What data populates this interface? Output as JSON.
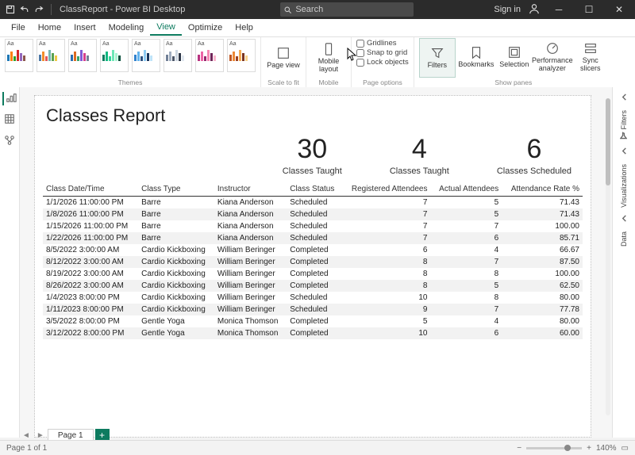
{
  "titlebar": {
    "app_title": "ClassReport - Power BI Desktop",
    "search_placeholder": "Search",
    "signin": "Sign in"
  },
  "menu": {
    "file": "File",
    "home": "Home",
    "insert": "Insert",
    "modeling": "Modeling",
    "view": "View",
    "optimize": "Optimize",
    "help": "Help"
  },
  "ribbon": {
    "group_themes": "Themes",
    "group_scale": "Scale to fit",
    "group_mobile": "Mobile",
    "group_pageopts": "Page options",
    "group_showpanes": "Show panes",
    "page_view": "Page view",
    "mobile_layout": "Mobile layout",
    "gridlines": "Gridlines",
    "snap": "Snap to grid",
    "lock": "Lock objects",
    "filters": "Filters",
    "bookmarks": "Bookmarks",
    "selection": "Selection",
    "perf": "Performance analyzer",
    "sync": "Sync slicers"
  },
  "right_panels": {
    "filters": "Filters",
    "visualizations": "Visualizations",
    "data": "Data"
  },
  "report": {
    "title": "Classes Report",
    "kpis": [
      {
        "value": "30",
        "label": "Classes Taught"
      },
      {
        "value": "4",
        "label": "Classes Taught"
      },
      {
        "value": "6",
        "label": "Classes Scheduled"
      }
    ],
    "columns": [
      "Class Date/Time",
      "Class Type",
      "Instructor",
      "Class Status",
      "Registered Attendees",
      "Actual Attendees",
      "Attendance Rate %"
    ],
    "rows": [
      [
        "1/1/2026 11:00:00 PM",
        "Barre",
        "Kiana Anderson",
        "Scheduled",
        "7",
        "5",
        "71.43"
      ],
      [
        "1/8/2026 11:00:00 PM",
        "Barre",
        "Kiana Anderson",
        "Scheduled",
        "7",
        "5",
        "71.43"
      ],
      [
        "1/15/2026 11:00:00 PM",
        "Barre",
        "Kiana Anderson",
        "Scheduled",
        "7",
        "7",
        "100.00"
      ],
      [
        "1/22/2026 11:00:00 PM",
        "Barre",
        "Kiana Anderson",
        "Scheduled",
        "7",
        "6",
        "85.71"
      ],
      [
        "8/5/2022 3:00:00 AM",
        "Cardio Kickboxing",
        "William Beringer",
        "Completed",
        "6",
        "4",
        "66.67"
      ],
      [
        "8/12/2022 3:00:00 AM",
        "Cardio Kickboxing",
        "William Beringer",
        "Completed",
        "8",
        "7",
        "87.50"
      ],
      [
        "8/19/2022 3:00:00 AM",
        "Cardio Kickboxing",
        "William Beringer",
        "Completed",
        "8",
        "8",
        "100.00"
      ],
      [
        "8/26/2022 3:00:00 AM",
        "Cardio Kickboxing",
        "William Beringer",
        "Completed",
        "8",
        "5",
        "62.50"
      ],
      [
        "1/4/2023 8:00:00 PM",
        "Cardio Kickboxing",
        "William Beringer",
        "Scheduled",
        "10",
        "8",
        "80.00"
      ],
      [
        "1/11/2023 8:00:00 PM",
        "Cardio Kickboxing",
        "William Beringer",
        "Scheduled",
        "9",
        "7",
        "77.78"
      ],
      [
        "3/5/2022 8:00:00 PM",
        "Gentle Yoga",
        "Monica Thomson",
        "Completed",
        "5",
        "4",
        "80.00"
      ],
      [
        "3/12/2022 8:00:00 PM",
        "Gentle Yoga",
        "Monica Thomson",
        "Completed",
        "10",
        "6",
        "60.00"
      ]
    ]
  },
  "pagebar": {
    "tab": "Page 1"
  },
  "status": {
    "left": "Page 1 of 1",
    "zoom": "140%"
  }
}
